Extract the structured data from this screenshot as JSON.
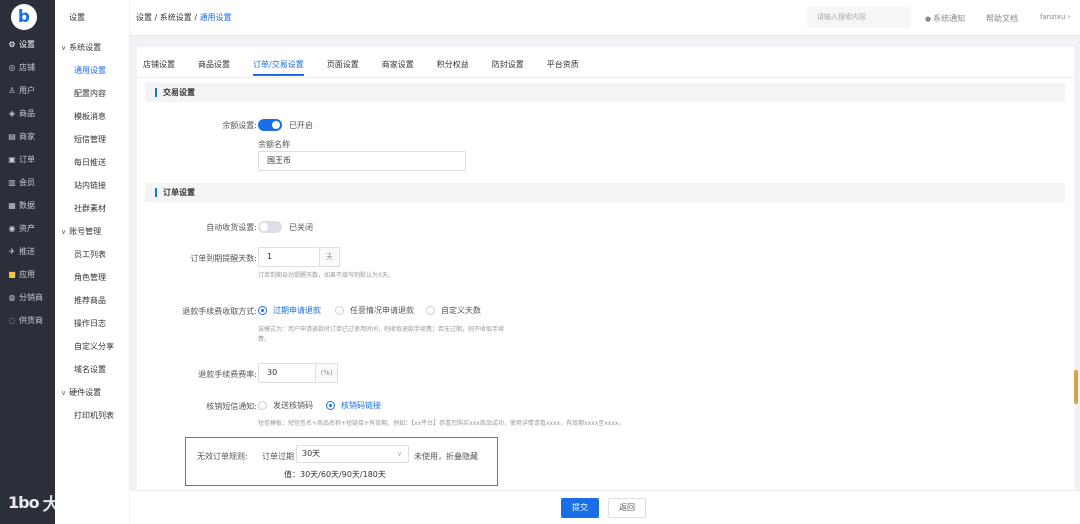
{
  "rail": {
    "logo": "b",
    "items": [
      {
        "label": "设置",
        "icon": "⚙"
      },
      {
        "label": "店铺",
        "icon": "◎"
      },
      {
        "label": "用户",
        "icon": "♙"
      },
      {
        "label": "商品",
        "icon": "◈"
      },
      {
        "label": "商家",
        "icon": "▤"
      },
      {
        "label": "订单",
        "icon": "▣"
      },
      {
        "label": "会员",
        "icon": "▥"
      },
      {
        "label": "数据",
        "icon": "▦"
      },
      {
        "label": "资产",
        "icon": "◉"
      },
      {
        "label": "推送",
        "icon": "✈"
      },
      {
        "label": "应用",
        "icon": "■"
      },
      {
        "label": "分销商",
        "icon": "◍"
      },
      {
        "label": "供货商",
        "icon": "◌"
      }
    ]
  },
  "sidebar": {
    "head": "设置",
    "group1": "系统设置",
    "group1_items": [
      "通用设置",
      "配置内容",
      "模板消息",
      "短信管理",
      "每日推送",
      "站内链接",
      "社群素材"
    ],
    "group2": "账号管理",
    "group2_items": [
      "员工列表",
      "角色管理",
      "推荐商品",
      "操作日志",
      "自定义分享",
      "域名设置"
    ],
    "group3": "硬件设置",
    "group3_items": [
      "打印机列表"
    ]
  },
  "header": {
    "breadcrumb_prefix": "设置 / 系统设置 / ",
    "breadcrumb_current": "通用设置",
    "search_placeholder": "请输入搜索内容",
    "notice": "系统通知",
    "help": "帮助文档",
    "user": "fanzixu"
  },
  "tabs": [
    "店铺设置",
    "商品设置",
    "订单/交易设置",
    "页面设置",
    "商家设置",
    "积分权益",
    "防封设置",
    "平台资质"
  ],
  "trade": {
    "section": "交易设置",
    "balance_label": "余额设置:",
    "balance_status": "已开启",
    "balance_name_label": "余额名称",
    "balance_name_value": "国王币"
  },
  "order": {
    "section": "订单设置",
    "auto_receive_label": "自动收货设置:",
    "auto_receive_status": "已关闭",
    "remind_label": "订单到期提醒天数:",
    "remind_value": "1",
    "remind_unit": "天",
    "remind_hint": "订单到期自动提醒天数，如果不填写则默认为3天。",
    "fee_label": "退款手续费收取方式:",
    "fee_options": [
      "过期申请退款",
      "任意情况申请退款",
      "自定义天数"
    ],
    "fee_hint_line1": "该模式为：用户申请退款时订单已过使用时间，则收取退款手续费；若无过期，则不收取手续",
    "fee_hint_line2": "费。",
    "rate_label": "退款手续费费率:",
    "rate_value": "30",
    "rate_unit": "(%)",
    "sms_label": "核销短信通知:",
    "sms_options": [
      "发送核销码",
      "核销码链接"
    ],
    "sms_hint": "短信模板：短信签名+商品名称+短链接+有效期。例如：【xx平台】恭喜您购买xxx商品成功，使用详情请看xxxx，有效期xxxx至xxxx。",
    "invalid_label": "无效订单规则:",
    "invalid_prefix": "订单过期",
    "invalid_value": "30天",
    "invalid_suffix": "未使用，折叠隐藏",
    "invalid_note": "值：30天/60天/90天/180天"
  },
  "footer": {
    "submit": "提交",
    "back": "返回"
  },
  "watermark": {
    "logo": "1bo",
    "text": "大数跨境"
  },
  "colors": {
    "accent": "#1a6ee8",
    "rail": "#2b2f3a",
    "highlight": "#e0474c"
  }
}
